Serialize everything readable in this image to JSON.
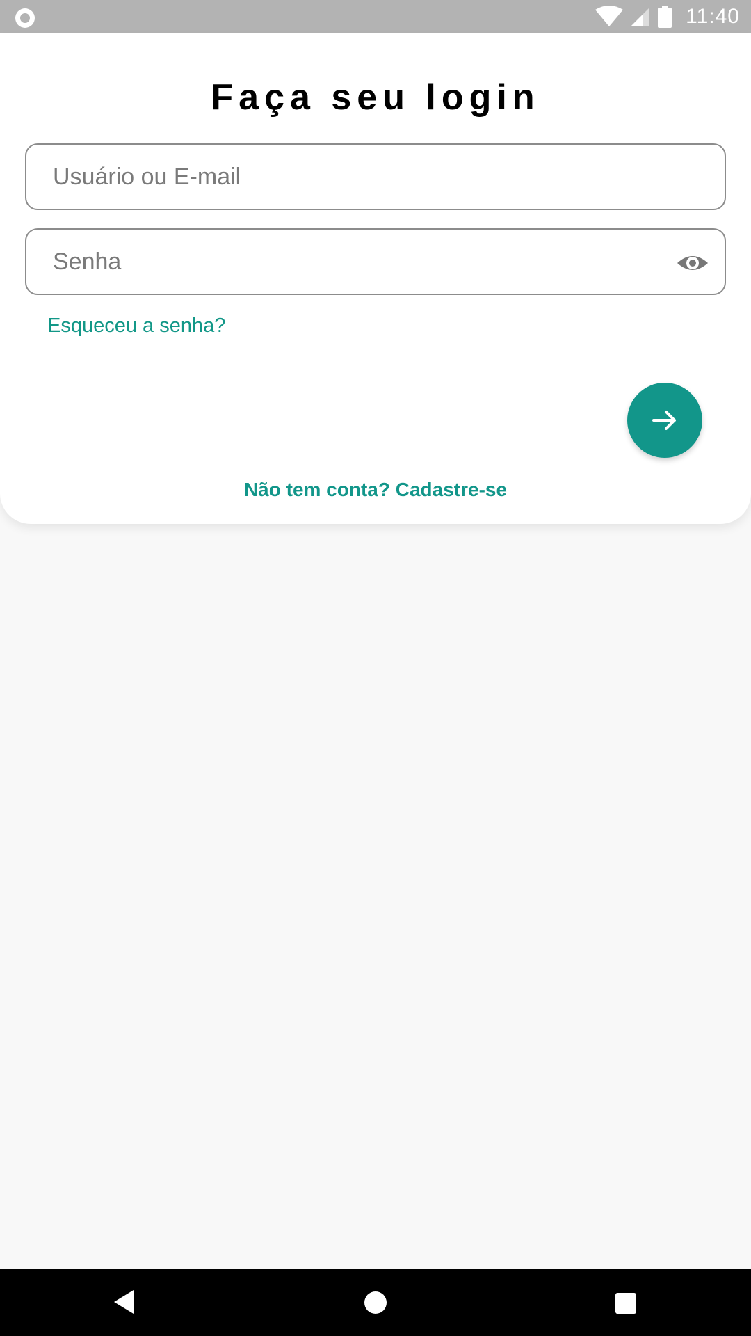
{
  "status_bar": {
    "time": "11:40",
    "icons": [
      "record-icon",
      "wifi-icon",
      "signal-icon",
      "battery-icon"
    ]
  },
  "login": {
    "title": "Faça seu login",
    "username_placeholder": "Usuário ou E-mail",
    "username_value": "",
    "password_placeholder": "Senha",
    "password_value": "",
    "password_toggle_icon": "eye-icon",
    "forgot_link": "Esqueceu a senha?",
    "submit_icon": "arrow-right-icon",
    "signup_link": "Não tem conta? Cadastre-se"
  },
  "nav_bar": {
    "buttons": [
      "back-icon",
      "home-icon",
      "recents-icon"
    ]
  },
  "colors": {
    "accent": "#12968a",
    "status_bar": "#b3b3b3",
    "background": "#f8f8f8"
  }
}
